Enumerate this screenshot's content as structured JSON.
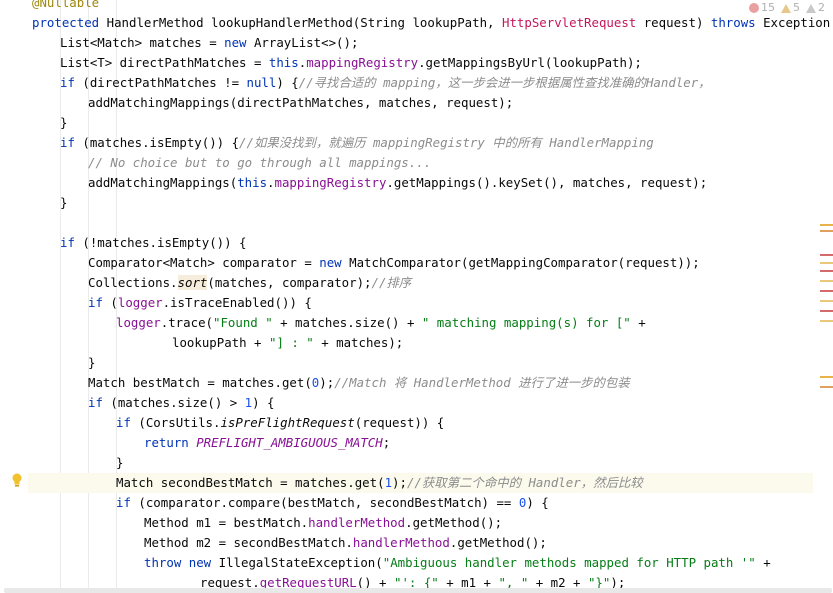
{
  "editor": {
    "language": "Java",
    "inspections": {
      "errors": "15",
      "warnings": "5",
      "weak_warnings": "2"
    },
    "current_line_index": 24,
    "colors": {
      "keyword": "#0033b3",
      "string": "#067d17",
      "number": "#1750eb",
      "field": "#871094",
      "comment": "#8c8c8c",
      "annotation": "#9e880d",
      "current_line": "#fcfaed"
    }
  },
  "code": [
    {
      "indent": 0,
      "tokens": [
        [
          "ann",
          "@Nullable"
        ]
      ]
    },
    {
      "indent": 0,
      "tokens": [
        [
          "kw",
          "protected "
        ],
        [
          "",
          "HandlerMethod "
        ],
        [
          "",
          "lookupHandlerMethod(String lookupPath, "
        ],
        [
          "red",
          "HttpServletRequest"
        ],
        [
          "",
          " request) "
        ],
        [
          "kw",
          "throws "
        ],
        [
          "",
          "Exception {"
        ]
      ]
    },
    {
      "indent": 1,
      "tokens": [
        [
          "",
          "List<Match> matches = "
        ],
        [
          "kw",
          "new "
        ],
        [
          "",
          "ArrayList<>();"
        ]
      ]
    },
    {
      "indent": 1,
      "tokens": [
        [
          "",
          "List<T> directPathMatches = "
        ],
        [
          "kw",
          "this"
        ],
        [
          "",
          "."
        ],
        [
          "fld",
          "mappingRegistry"
        ],
        [
          "",
          ".getMappingsByUrl(lookupPath);"
        ]
      ]
    },
    {
      "indent": 1,
      "tokens": [
        [
          "kw",
          "if "
        ],
        [
          "",
          "(directPathMatches != "
        ],
        [
          "kw",
          "null"
        ],
        [
          "",
          ") {"
        ],
        [
          "cm",
          "//寻找合适的 mapping，这一步会进一步根据属性查找准确的Handler，"
        ]
      ]
    },
    {
      "indent": 2,
      "tokens": [
        [
          "",
          "addMatchingMappings(directPathMatches, matches, request);"
        ]
      ]
    },
    {
      "indent": 1,
      "tokens": [
        [
          "",
          "}"
        ]
      ]
    },
    {
      "indent": 1,
      "tokens": [
        [
          "kw",
          "if "
        ],
        [
          "",
          "(matches.isEmpty()) {"
        ],
        [
          "cm",
          "//如果没找到，就遍历 mappingRegistry 中的所有 HandlerMapping"
        ]
      ]
    },
    {
      "indent": 2,
      "tokens": [
        [
          "cm",
          "// No choice but to go through all mappings..."
        ]
      ]
    },
    {
      "indent": 2,
      "tokens": [
        [
          "",
          "addMatchingMappings("
        ],
        [
          "kw",
          "this"
        ],
        [
          "",
          "."
        ],
        [
          "fld",
          "mappingRegistry"
        ],
        [
          "",
          ".getMappings().keySet(), matches, request);"
        ]
      ]
    },
    {
      "indent": 1,
      "tokens": [
        [
          "",
          "}"
        ]
      ]
    },
    {
      "indent": 0,
      "tokens": []
    },
    {
      "indent": 1,
      "tokens": [
        [
          "kw",
          "if "
        ],
        [
          "",
          "(!matches.isEmpty()) {"
        ]
      ]
    },
    {
      "indent": 2,
      "tokens": [
        [
          "",
          "Comparator<Match> comparator = "
        ],
        [
          "kw",
          "new "
        ],
        [
          "",
          "MatchComparator(getMappingComparator(request));"
        ]
      ]
    },
    {
      "indent": 2,
      "tokens": [
        [
          "",
          "Collections."
        ],
        [
          "stat hl-sort",
          "sort"
        ],
        [
          "",
          "(matches, comparator);"
        ],
        [
          "cm",
          "//排序"
        ]
      ]
    },
    {
      "indent": 2,
      "tokens": [
        [
          "kw",
          "if "
        ],
        [
          "",
          "("
        ],
        [
          "fld",
          "logger"
        ],
        [
          "",
          ".isTraceEnabled()) {"
        ]
      ]
    },
    {
      "indent": 3,
      "tokens": [
        [
          "fld",
          "logger"
        ],
        [
          "",
          ".trace("
        ],
        [
          "str",
          "\"Found \""
        ],
        [
          "",
          " + matches.size() + "
        ],
        [
          "str",
          "\" matching mapping(s) for [\""
        ],
        [
          "",
          " +"
        ]
      ]
    },
    {
      "indent": 5,
      "tokens": [
        [
          "",
          "lookupPath + "
        ],
        [
          "str",
          "\"] : \""
        ],
        [
          "",
          " + matches);"
        ]
      ]
    },
    {
      "indent": 2,
      "tokens": [
        [
          "",
          "}"
        ]
      ]
    },
    {
      "indent": 2,
      "tokens": [
        [
          "",
          "Match bestMatch = matches.get("
        ],
        [
          "num",
          "0"
        ],
        [
          "",
          ");"
        ],
        [
          "cm",
          "//Match 将 HandlerMethod 进行了进一步的包装"
        ]
      ]
    },
    {
      "indent": 2,
      "tokens": [
        [
          "kw",
          "if "
        ],
        [
          "",
          "(matches.size() > "
        ],
        [
          "num",
          "1"
        ],
        [
          "",
          ") {"
        ]
      ]
    },
    {
      "indent": 3,
      "tokens": [
        [
          "kw",
          "if "
        ],
        [
          "",
          "(CorsUtils."
        ],
        [
          "stat",
          "isPreFlightRequest"
        ],
        [
          "",
          "(request)) {"
        ]
      ]
    },
    {
      "indent": 4,
      "tokens": [
        [
          "kw",
          "return "
        ],
        [
          "const",
          "PREFLIGHT_AMBIGUOUS_MATCH"
        ],
        [
          "",
          ";"
        ]
      ]
    },
    {
      "indent": 3,
      "tokens": [
        [
          "",
          "}"
        ]
      ]
    },
    {
      "indent": 3,
      "tokens": [
        [
          "",
          "Match secondBestMatch = matches.get("
        ],
        [
          "num",
          "1"
        ],
        [
          "",
          ");"
        ],
        [
          "cm",
          "//获取第二个命中的 Handler，然后比较"
        ]
      ]
    },
    {
      "indent": 3,
      "tokens": [
        [
          "kw",
          "if "
        ],
        [
          "",
          "(comparator.compare(bestMatch, secondBestMatch) == "
        ],
        [
          "num",
          "0"
        ],
        [
          "",
          ") {"
        ]
      ]
    },
    {
      "indent": 4,
      "tokens": [
        [
          "",
          "Method m1 = bestMatch."
        ],
        [
          "fld",
          "handlerMethod"
        ],
        [
          "",
          ".getMethod();"
        ]
      ]
    },
    {
      "indent": 4,
      "tokens": [
        [
          "",
          "Method m2 = secondBestMatch."
        ],
        [
          "fld",
          "handlerMethod"
        ],
        [
          "",
          ".getMethod();"
        ]
      ]
    },
    {
      "indent": 4,
      "tokens": [
        [
          "kw",
          "throw new "
        ],
        [
          "",
          "IllegalStateException("
        ],
        [
          "str",
          "\"Ambiguous handler methods mapped for HTTP path '\""
        ],
        [
          "",
          " +"
        ]
      ]
    },
    {
      "indent": 6,
      "tokens": [
        [
          "",
          "request."
        ],
        [
          "fld",
          "getRequestURL"
        ],
        [
          "",
          "() + "
        ],
        [
          "str",
          "\"': {\""
        ],
        [
          "",
          " + m1 + "
        ],
        [
          "str",
          "\", \""
        ],
        [
          "",
          " + m2 + "
        ],
        [
          "str",
          "\"}\""
        ],
        [
          "",
          ");"
        ]
      ]
    }
  ]
}
